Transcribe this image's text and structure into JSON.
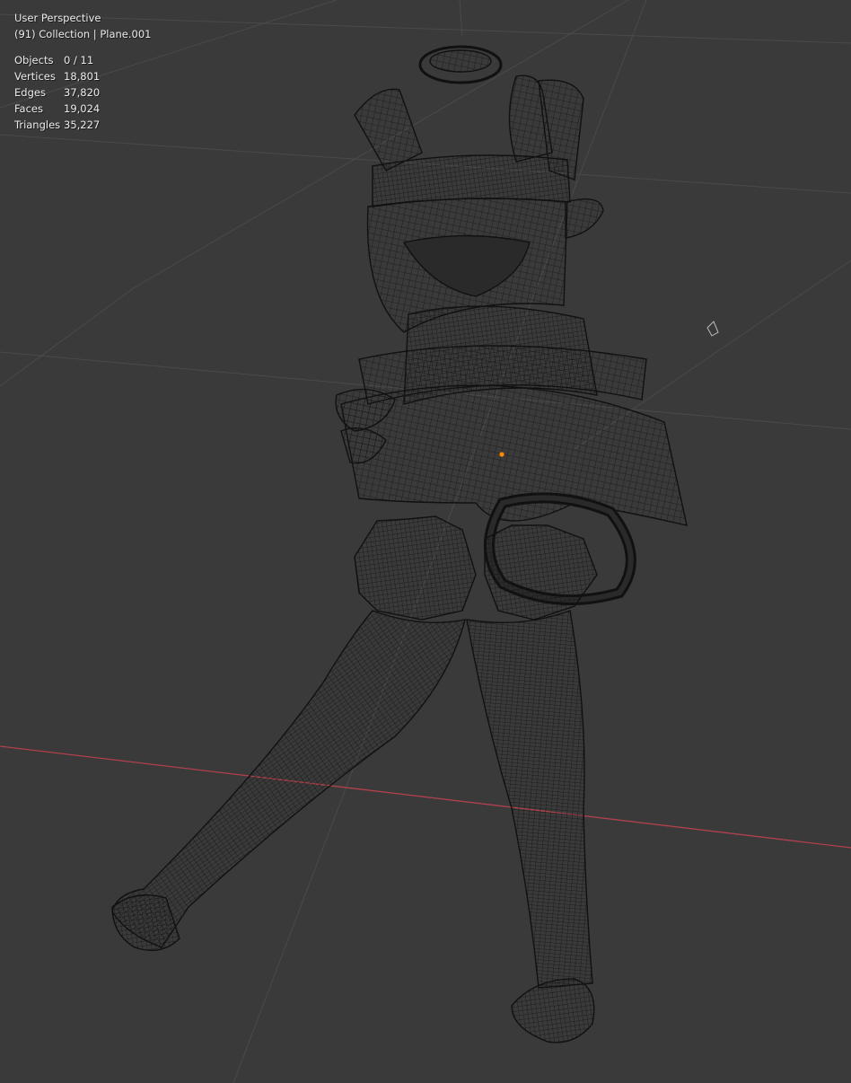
{
  "viewport": {
    "view_label": "User Perspective",
    "collection_label": "(91) Collection | Plane.001",
    "background": "#3a3a3a",
    "grid_color": "#4a4a4a",
    "x_axis_color": "#b0414d",
    "wire_color": "#141414",
    "origin_color": "#ff8a00"
  },
  "stats": [
    {
      "label": "Objects",
      "value": "0 / 11"
    },
    {
      "label": "Vertices",
      "value": "18,801"
    },
    {
      "label": "Edges",
      "value": "37,820"
    },
    {
      "label": "Faces",
      "value": "19,024"
    },
    {
      "label": "Triangles",
      "value": "35,227"
    }
  ]
}
